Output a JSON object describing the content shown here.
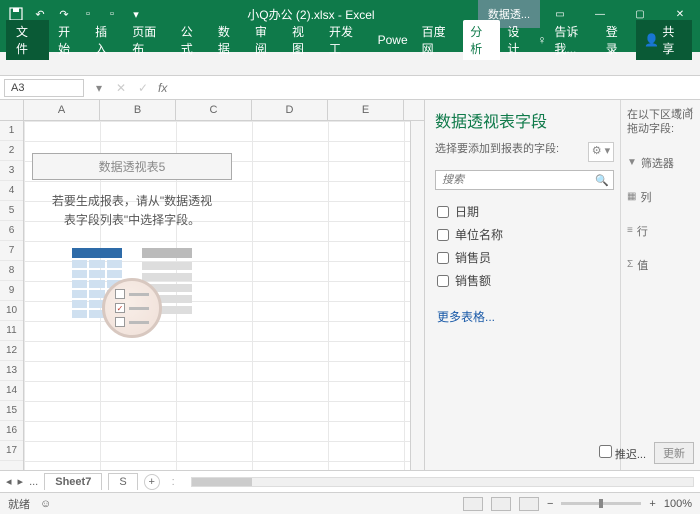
{
  "title": "小Q办公 (2).xlsx - Excel",
  "context_tab": "数据透...",
  "tabs": {
    "file": "文件",
    "items": [
      "开始",
      "插入",
      "页面布",
      "公式",
      "数据",
      "审阅",
      "视图",
      "开发工",
      "Powe",
      "百度网",
      "分析",
      "设计"
    ],
    "active_index": 10,
    "tell_me": "告诉我...",
    "login": "登录",
    "share": "共享"
  },
  "namebox": "A3",
  "columns": [
    "A",
    "B",
    "C",
    "D",
    "E"
  ],
  "rows": [
    "1",
    "2",
    "3",
    "4",
    "5",
    "6",
    "7",
    "8",
    "9",
    "10",
    "11",
    "12",
    "13",
    "14",
    "15",
    "16",
    "17"
  ],
  "placeholder": {
    "title": "数据透视表5",
    "line1": "若要生成报表，请从\"数据透视",
    "line2": "表字段列表\"中选择字段。"
  },
  "pane": {
    "title": "数据透视表字段",
    "sub": "选择要添加到报表的字段:",
    "search_ph": "搜索",
    "fields": [
      "日期",
      "单位名称",
      "销售员",
      "销售额"
    ],
    "more": "更多表格...",
    "areas_title": "在以下区域间拖动字段:",
    "zone_filter": "筛选器",
    "zone_cols": "列",
    "zone_rows": "行",
    "zone_vals": "值",
    "defer": "推迟...",
    "update": "更新"
  },
  "sheet_tabs": {
    "nav": "...",
    "active": "Sheet7",
    "next": "S"
  },
  "status": {
    "ready": "就绪",
    "acc": "",
    "zoom": "100%"
  }
}
